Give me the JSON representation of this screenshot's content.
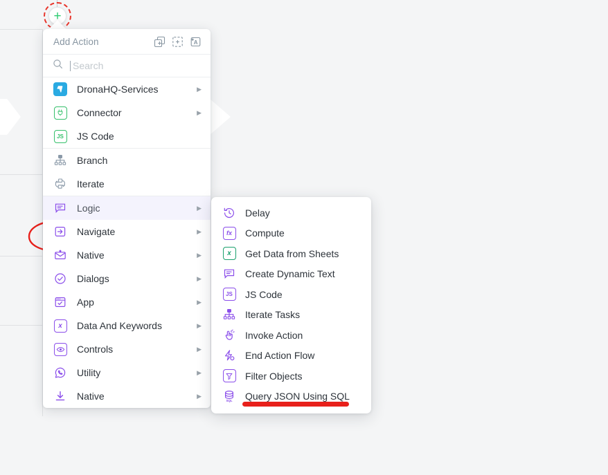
{
  "canvas": {
    "background_color": "#f4f5f6",
    "add_node_icon": "plus-icon",
    "add_node_label": "+"
  },
  "annotations": {
    "dashed_circle_color": "#e8342a",
    "arc_color": "#e8201b",
    "underline_color": "#e8201b",
    "underline_target": "Query JSON Using SQL"
  },
  "menu": {
    "title": "Add Action",
    "header_icons": [
      {
        "name": "duplicate-add-icon"
      },
      {
        "name": "select-add-icon"
      },
      {
        "name": "text-block-add-icon"
      }
    ],
    "search": {
      "placeholder": "Search",
      "value": ""
    },
    "groups": [
      {
        "items": [
          {
            "label": "DronaHQ-Services",
            "icon": "dronahq-icon",
            "icon_color": "#2aaae2",
            "has_submenu": true,
            "active": false
          },
          {
            "label": "Connector",
            "icon": "plug-icon",
            "icon_color": "#34c06a",
            "has_submenu": true,
            "active": false
          },
          {
            "label": "JS Code",
            "icon": "js-icon",
            "icon_color": "#34c06a",
            "has_submenu": false,
            "active": false
          }
        ]
      },
      {
        "items": [
          {
            "label": "Branch",
            "icon": "branch-icon",
            "icon_color": "#8a99a8",
            "has_submenu": false,
            "active": false
          },
          {
            "label": "Iterate",
            "icon": "iterate-icon",
            "icon_color": "#8a99a8",
            "has_submenu": false,
            "active": false
          }
        ]
      },
      {
        "items": [
          {
            "label": "Logic",
            "icon": "logic-icon",
            "icon_color": "#8a4dea",
            "has_submenu": true,
            "active": true
          },
          {
            "label": "Navigate",
            "icon": "navigate-icon",
            "icon_color": "#8a4dea",
            "has_submenu": true,
            "active": false
          },
          {
            "label": "Native",
            "icon": "mail-icon",
            "icon_color": "#8a4dea",
            "has_submenu": true,
            "active": false
          },
          {
            "label": "Dialogs",
            "icon": "check-circle-icon",
            "icon_color": "#8a4dea",
            "has_submenu": true,
            "active": false
          },
          {
            "label": "App",
            "icon": "app-window-icon",
            "icon_color": "#8a4dea",
            "has_submenu": true,
            "active": false
          },
          {
            "label": "Data And Keywords",
            "icon": "variable-x-icon",
            "icon_color": "#8a4dea",
            "has_submenu": true,
            "active": false
          },
          {
            "label": "Controls",
            "icon": "eye-icon",
            "icon_color": "#8a4dea",
            "has_submenu": true,
            "active": false
          },
          {
            "label": "Utility",
            "icon": "phone-icon",
            "icon_color": "#8a4dea",
            "has_submenu": true,
            "active": false
          },
          {
            "label": "Native",
            "icon": "download-icon",
            "icon_color": "#8a4dea",
            "has_submenu": true,
            "active": false
          }
        ]
      }
    ]
  },
  "submenu": {
    "parent": "Logic",
    "items": [
      {
        "label": "Delay",
        "icon": "clock-rewind-icon",
        "icon_color": "#8a4dea"
      },
      {
        "label": "Compute",
        "icon": "function-fx-icon",
        "icon_color": "#8a4dea"
      },
      {
        "label": "Get Data from Sheets",
        "icon": "sheets-x-icon",
        "icon_color": "#1aa06d"
      },
      {
        "label": "Create Dynamic Text",
        "icon": "dynamic-text-icon",
        "icon_color": "#8a4dea"
      },
      {
        "label": "JS Code",
        "icon": "js-icon",
        "icon_color": "#8a4dea"
      },
      {
        "label": "Iterate Tasks",
        "icon": "branch-icon",
        "icon_color": "#8a4dea"
      },
      {
        "label": "Invoke Action",
        "icon": "click-hand-icon",
        "icon_color": "#8a4dea"
      },
      {
        "label": "End Action Flow",
        "icon": "end-flow-icon",
        "icon_color": "#8a4dea"
      },
      {
        "label": "Filter Objects",
        "icon": "filter-icon",
        "icon_color": "#8a4dea"
      },
      {
        "label": "Query JSON Using SQL",
        "icon": "database-sql-icon",
        "icon_color": "#8a4dea"
      }
    ]
  }
}
